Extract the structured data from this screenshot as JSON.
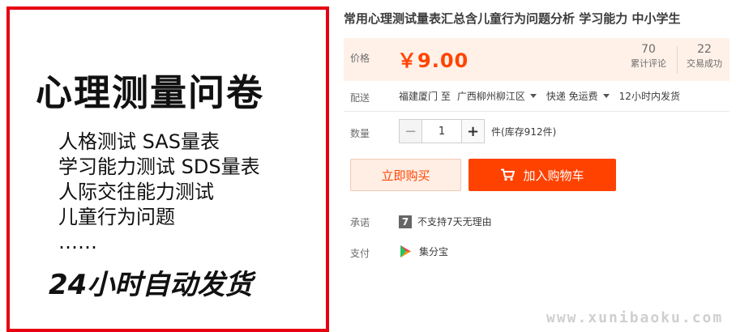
{
  "image": {
    "title": "心理测量问卷",
    "lines": [
      "人格测试   SAS量表",
      "学习能力测试  SDS量表",
      "人际交往能力测试",
      "儿童行为问题",
      "……"
    ],
    "footer": "24小时自动发货"
  },
  "product": {
    "title": "常用心理测试量表汇总含儿童行为问题分析 学习能力 中小学生"
  },
  "price": {
    "label": "价格",
    "value": "￥9.00",
    "reviews_count": "70",
    "reviews_label": "累计评论",
    "deals_count": "22",
    "deals_label": "交易成功"
  },
  "delivery": {
    "label": "配送",
    "origin": "福建厦门 至",
    "destination": "广西柳州柳江区",
    "shipping": "快递 免运费",
    "ship_time": "12小时内发货"
  },
  "quantity": {
    "label": "数量",
    "minus": "−",
    "value": "1",
    "plus": "+",
    "stock": "件(库存912件)"
  },
  "actions": {
    "buy_now": "立即购买",
    "add_cart": "加入购物车"
  },
  "promise": {
    "label": "承诺",
    "icon_text": "7",
    "text": "不支持7天无理由"
  },
  "payment": {
    "label": "支付",
    "text": "集分宝"
  },
  "watermark": "www.xunibaoku.com",
  "colors": {
    "accent": "#ff4400",
    "frame_red": "#e60012",
    "price_bg": "#fff1e8"
  }
}
